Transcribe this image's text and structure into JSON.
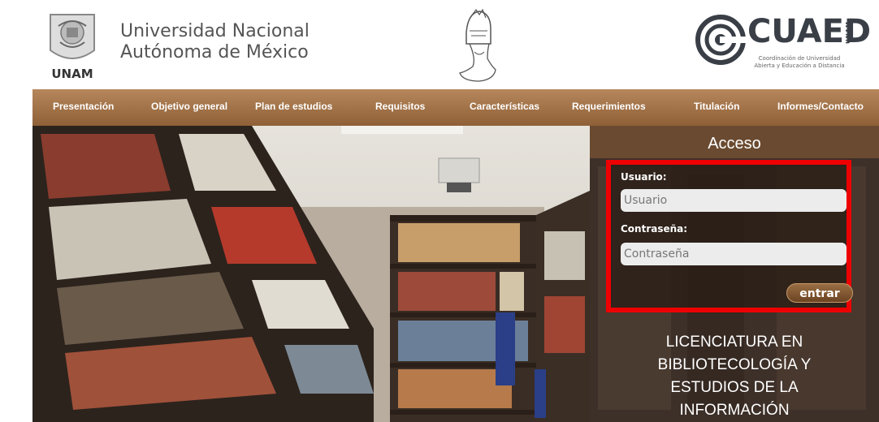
{
  "header": {
    "unam_logo_text": "UNAM",
    "title_line1": "Universidad Nacional",
    "title_line2": "Autónoma de México",
    "cuaed_logo_text": "CUAED",
    "cuaed_subtitle": "Coordinación de Universidad Abierta y Educación a Distancia",
    "cuaed_vertical": "UNAM"
  },
  "nav": {
    "items": [
      {
        "label": "Presentación"
      },
      {
        "label": "Objetivo general"
      },
      {
        "label": "Plan de estudios"
      },
      {
        "label": "Requisitos"
      },
      {
        "label": "Características"
      },
      {
        "label": "Requerimientos"
      },
      {
        "label": "Titulación"
      },
      {
        "label": "Informes/Contacto"
      }
    ]
  },
  "login": {
    "title": "Acceso",
    "user_label": "Usuario:",
    "user_placeholder": "Usuario",
    "password_label": "Contraseña:",
    "password_placeholder": "Contraseña",
    "submit_label": "entrar"
  },
  "program": {
    "line1": "LICENCIATURA EN",
    "line2": "BIBLIOTECOLOGÍA Y",
    "line3": "ESTUDIOS DE LA",
    "line4": "INFORMACIÓN"
  },
  "colors": {
    "nav_brown": "#a0703f",
    "highlight_red": "#ee0000"
  }
}
